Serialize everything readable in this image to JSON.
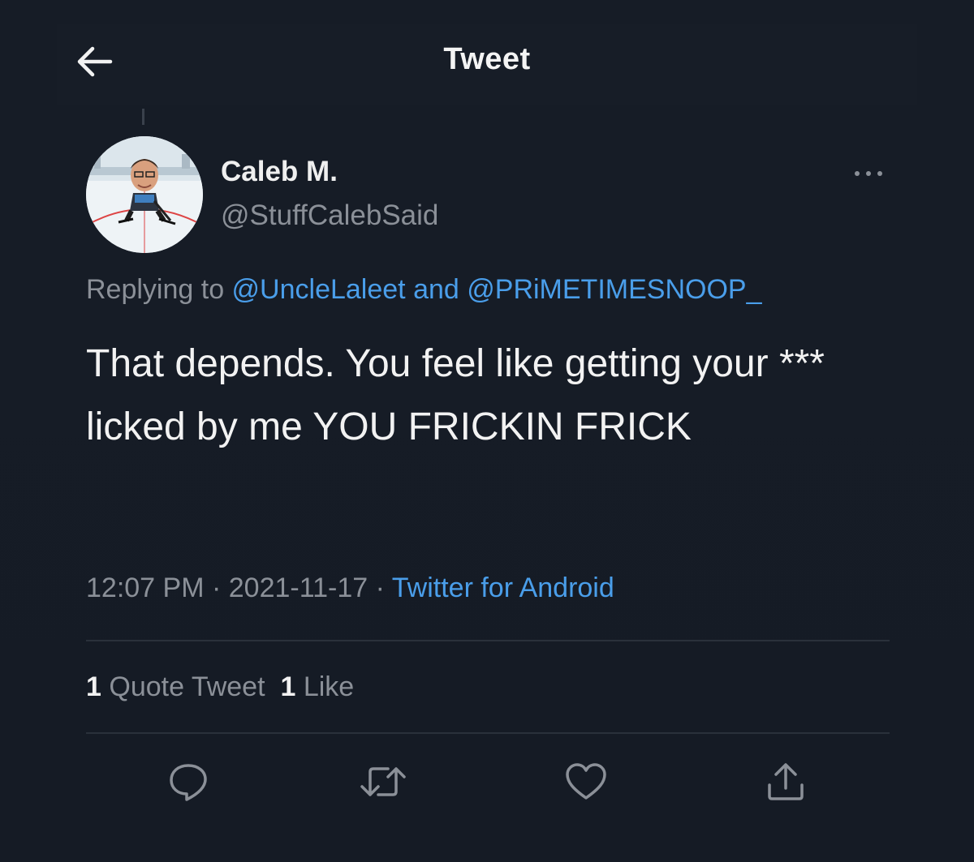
{
  "header": {
    "title": "Tweet",
    "back_icon": "arrow-left-icon"
  },
  "tweet": {
    "author_name": "Caleb M.",
    "author_handle": "@StuffCalebSaid",
    "replying_prefix": "Replying to ",
    "mention_1": "@UncleLaleet",
    "replying_and": " and ",
    "mention_2": "@PRiMETIMESNOOP_",
    "text": "That depends. You feel like getting your *** licked by me YOU FRICKIN FRICK",
    "time": "12:07 PM",
    "separator": " · ",
    "date": "2021-11-17",
    "source": "Twitter for Android"
  },
  "stats": {
    "quote_count": "1",
    "quote_label": "Quote Tweet",
    "like_count": "1",
    "like_label": "Like"
  },
  "actions": [
    "reply-icon",
    "retweet-icon",
    "like-icon",
    "share-icon"
  ],
  "colors": {
    "background": "#151b25",
    "link": "#4a9eea",
    "secondary_text": "#8b9098",
    "primary_text": "#f2f2f2"
  }
}
